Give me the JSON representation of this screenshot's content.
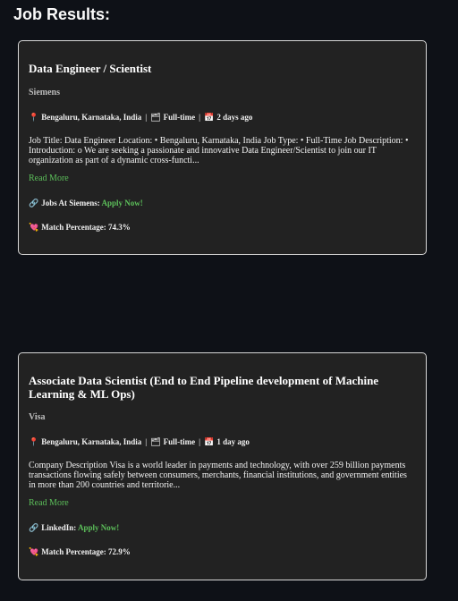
{
  "heading": "Job Results:",
  "jobs": [
    {
      "title": "Data Engineer / Scientist",
      "company": "Siemens",
      "location": "Bengaluru, Karnataka, India",
      "type": "Full-time",
      "posted": "2 days ago",
      "description": "Job Title: Data Engineer Location: • Bengaluru, Karnataka, India Job Type: • Full-Time Job Description: • Introduction: o We are seeking a passionate and innovative Data Engineer/Scientist to join our IT organization as part of a dynamic cross-functi...",
      "read_more": "Read More",
      "source_label": "Jobs At Siemens:",
      "apply_label": "Apply Now!",
      "match_label": "Match Percentage:",
      "match_value": "74.3%"
    },
    {
      "title": "Associate Data Scientist (End to End Pipeline development of Machine Learning & ML Ops)",
      "company": "Visa",
      "location": "Bengaluru, Karnataka, India",
      "type": "Full-time",
      "posted": "1 day ago",
      "description": "Company Description Visa is a world leader in payments and technology, with over 259 billion payments transactions flowing safely between consumers, merchants, financial institutions, and government entities in more than 200 countries and territorie...",
      "read_more": "Read More",
      "source_label": "LinkedIn:",
      "apply_label": "Apply Now!",
      "match_label": "Match Percentage:",
      "match_value": "72.9%"
    }
  ],
  "icons": {
    "location": "pin-icon",
    "type": "briefcase-icon",
    "posted": "calendar-icon",
    "source": "link-icon",
    "match": "heart-icon"
  },
  "colors": {
    "background": "#0e1117",
    "card": "#222222",
    "accent_green": "#5cbf5a"
  }
}
